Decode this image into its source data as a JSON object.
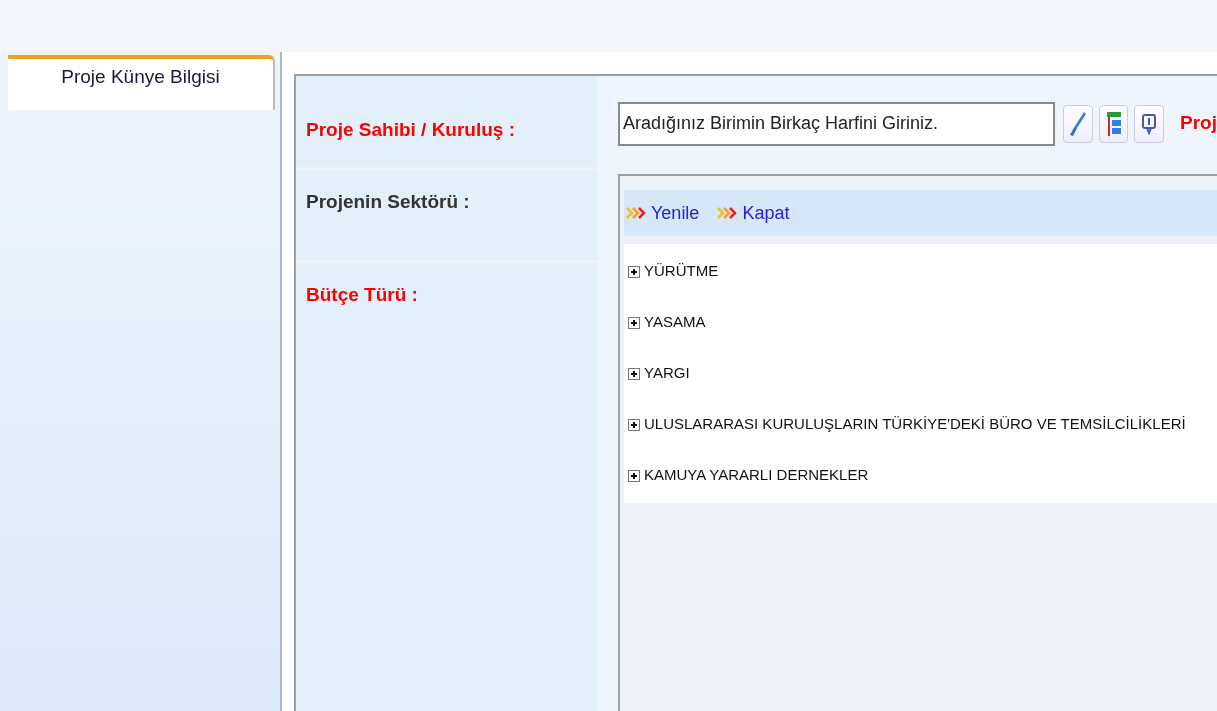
{
  "tabs": [
    {
      "label": "Proje Künye Bilgisi",
      "selected": true
    }
  ],
  "form": {
    "rows": [
      {
        "label": "Proje Sahibi / Kuruluş :",
        "required": true
      },
      {
        "label": "Projenin Sektörü :",
        "required": false
      },
      {
        "label": "Bütçe Türü :",
        "required": true
      }
    ],
    "search": {
      "placeholder": "Aradığınız Birimin Birkaç Harfini Giriniz."
    },
    "next_label": "Proj",
    "tree_toolbar": [
      "Yenile",
      "Kapat"
    ],
    "tree": [
      {
        "label": "YÜRÜTME",
        "expanded": false
      },
      {
        "label": "YASAMA",
        "expanded": false
      },
      {
        "label": "YARGI",
        "expanded": false
      },
      {
        "label": "ULUSLARARASI KURULUŞLARIN TÜRKİYE'DEKİ BÜRO VE TEMSİLCİLİKLERİ",
        "expanded": false
      },
      {
        "label": "KAMUYA YARARLI DERNEKLER",
        "expanded": false
      }
    ]
  }
}
